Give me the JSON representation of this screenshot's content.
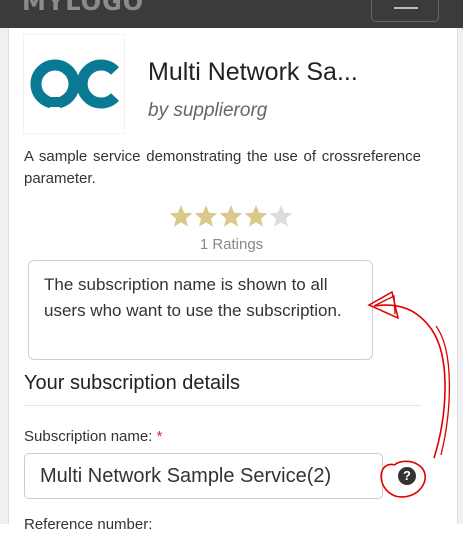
{
  "header": {
    "brand": "MYLOGO",
    "menu_icon": "hamburger-menu-icon"
  },
  "service": {
    "logo_text": "OC",
    "title": "Multi Network Sa...",
    "provider": "by supplierorg",
    "description": "A sample service demonstrating the use of crossreference parameter.",
    "rating": {
      "value": 4,
      "max": 5,
      "count_text": "1 Ratings",
      "filled_color": "#d9c98a",
      "empty_color": "#dcdcdc"
    }
  },
  "tooltip": {
    "text": "The subscription name is shown to all users who want to use the subscription."
  },
  "form": {
    "section_title": "Your subscription details",
    "subscription_name": {
      "label": "Subscription name:",
      "required_mark": "*",
      "value": "Multi Network Sample Service(2)",
      "help_icon": "question-circle-icon"
    },
    "next_field_label": "Reference number:"
  },
  "colors": {
    "logo": "#0a7a94",
    "annotation": "#e00000",
    "topbar": "#3a3b3d"
  }
}
